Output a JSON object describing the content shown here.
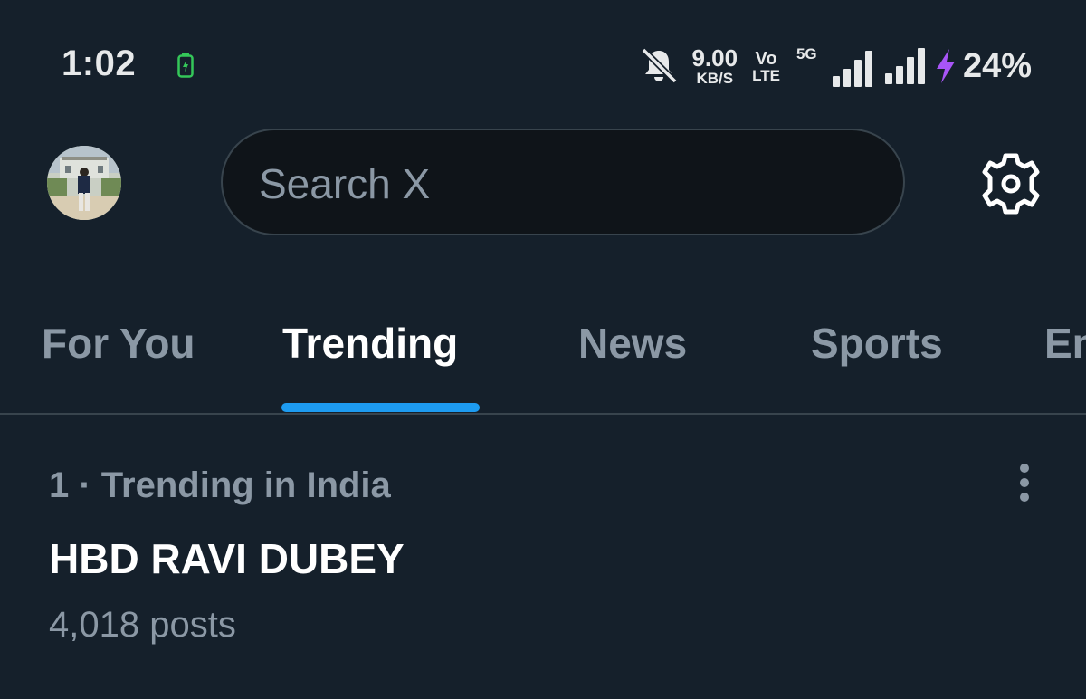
{
  "status_bar": {
    "time": "1:02",
    "net_speed_value": "9.00",
    "net_speed_unit": "KB/S",
    "volte_top": "Vo",
    "volte_bottom": "LTE",
    "network_type": "5G",
    "battery_percent": "24%",
    "icons": [
      "battery-charging-icon",
      "mute-icon",
      "signal-icon",
      "charging-bolt-icon"
    ]
  },
  "header": {
    "search_placeholder": "Search X",
    "icons": [
      "avatar",
      "gear-icon"
    ]
  },
  "tabs": [
    {
      "label": "For You",
      "active": false
    },
    {
      "label": "Trending",
      "active": true
    },
    {
      "label": "News",
      "active": false
    },
    {
      "label": "Sports",
      "active": false
    },
    {
      "label": "En",
      "active": false
    }
  ],
  "trend": {
    "meta": "1 · Trending in India",
    "name": "HBD RAVI DUBEY",
    "posts": "4,018 posts"
  },
  "colors": {
    "background": "#15202b",
    "accent": "#1d9bf0",
    "muted_text": "#8b98a5",
    "charging_green": "#34c759",
    "charging_purple": "#a855f7"
  }
}
